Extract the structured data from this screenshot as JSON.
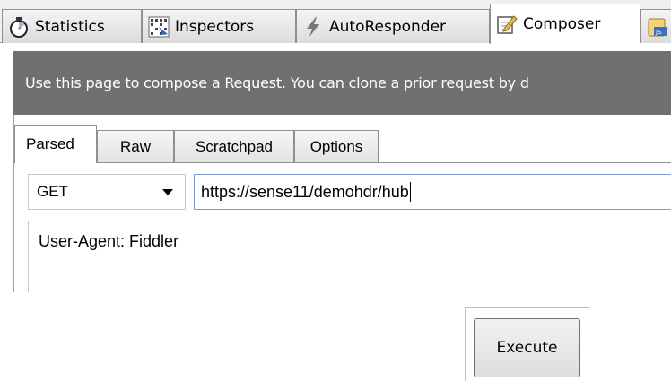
{
  "top_tabs": [
    {
      "label": "Statistics",
      "icon": "stopwatch-icon"
    },
    {
      "label": "Inspectors",
      "icon": "inspectors-grid-icon"
    },
    {
      "label": "AutoResponder",
      "icon": "lightning-icon"
    },
    {
      "label": "Composer",
      "icon": "compose-pencil-icon",
      "active": true
    },
    {
      "label": "",
      "icon": "json-script-icon"
    }
  ],
  "banner": {
    "text": "Use this page to compose a Request. You can clone a prior request by d"
  },
  "composer": {
    "subtabs": [
      {
        "label": "Parsed",
        "active": true
      },
      {
        "label": "Raw"
      },
      {
        "label": "Scratchpad"
      },
      {
        "label": "Options"
      }
    ],
    "method": "GET",
    "url": "https://sense11/demohdr/hub",
    "headers": "User-Agent: Fiddler"
  },
  "execute_label": "Execute",
  "colors": {
    "banner_bg": "#707070",
    "banner_text": "#ffffff",
    "url_border": "#7a9cd3"
  }
}
